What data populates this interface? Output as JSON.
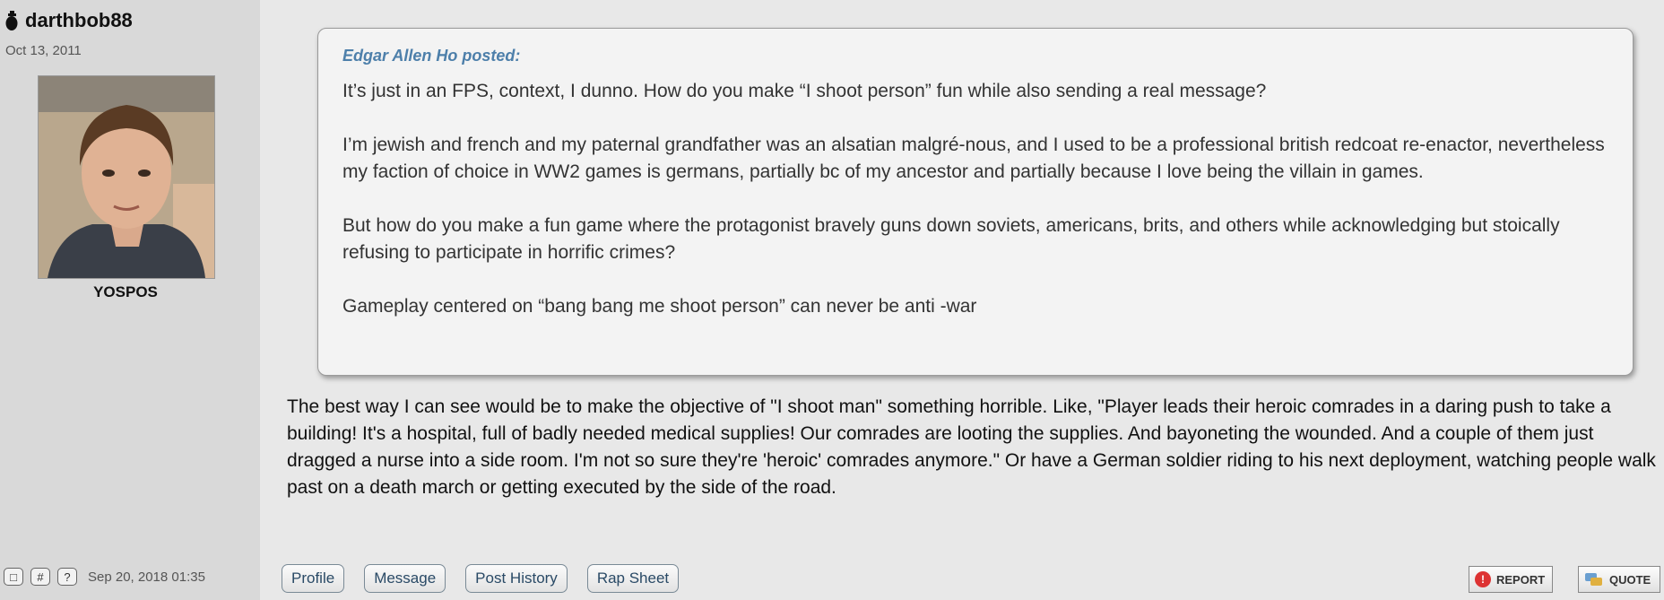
{
  "user": {
    "name": "darthbob88",
    "regdate": "Oct 13, 2011",
    "title": "YOSPOS"
  },
  "post": {
    "date": "Sep 20, 2018 01:35",
    "meta_buttons": [
      "□",
      "#",
      "?"
    ],
    "quote": {
      "author": "Edgar Allen Ho posted:",
      "paragraphs": [
        "It’s just in an FPS, context, I dunno. How do you make “I shoot person” fun while also sending a real message?",
        "I’m jewish and french and my paternal grandfather was an alsatian malgré-nous, and I used to be a professional british redcoat re-enactor, nevertheless my faction of choice in WW2 games is germans, partially bc of my ancestor and partially because I love being the villain in games.",
        "But how do you make a fun game where the protagonist bravely guns down soviets, americans, brits, and others while acknowledging but stoically refusing to participate in horrific crimes?",
        "Gameplay centered on “bang bang me shoot person” can never be anti -war"
      ]
    },
    "body": "The best way I can see would be to make the objective of \"I shoot man\" something horrible. Like, \"Player leads their heroic comrades in a daring push to take a building! It's a hospital, full of badly needed medical supplies! Our comrades are looting the supplies. And bayoneting the wounded. And a couple of them just dragged a nurse into a side room. I'm not so sure they're 'heroic' comrades anymore.\" Or have a German soldier riding to his next deployment, watching people walk past on a death march or getting executed by the side of the road."
  },
  "buttons": {
    "profile": "Profile",
    "message": "Message",
    "post_history": "Post History",
    "rap_sheet": "Rap Sheet",
    "report": "REPORT",
    "quote": "QUOTE"
  },
  "colors": {
    "quote_author": "#4d7faa",
    "sidebar_bg": "#d9d9d9",
    "main_bg": "#e8e8e8"
  }
}
